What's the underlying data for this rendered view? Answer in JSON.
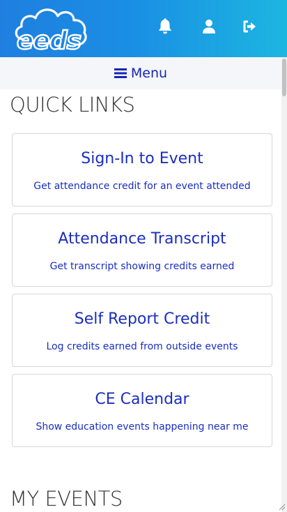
{
  "header": {
    "logo_text": "eeds",
    "icons": {
      "notifications": "bell-icon",
      "profile": "user-icon",
      "logout": "sign-out-icon"
    },
    "colors": {
      "gradient_start": "#1f7fdf",
      "gradient_end": "#1cb6e0"
    }
  },
  "menu": {
    "icon": "bars-icon",
    "label": "Menu"
  },
  "quick_links": {
    "title": "QUICK LINKS",
    "cards": [
      {
        "title": "Sign-In to Event",
        "description": "Get attendance credit for an event attended"
      },
      {
        "title": "Attendance Transcript",
        "description": "Get transcript showing credits earned"
      },
      {
        "title": "Self Report Credit",
        "description": "Log credits earned from outside events"
      },
      {
        "title": "CE Calendar",
        "description": "Show education events happening near me"
      }
    ]
  },
  "my_events": {
    "title": "MY EVENTS"
  },
  "theme": {
    "link_color": "#1a2ec0",
    "heading_color": "#333333"
  }
}
